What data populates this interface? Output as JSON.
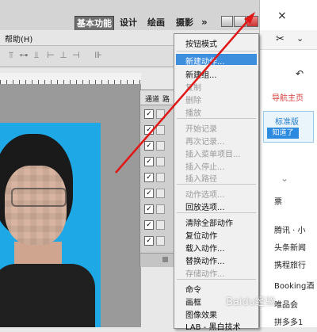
{
  "workspace": {
    "basic": "基本功能",
    "design": "设计",
    "paint": "绘画",
    "photo": "摄影",
    "more": "»"
  },
  "menubar": {
    "help": "帮助(H)"
  },
  "actions_panel": {
    "tab1": "通道",
    "tab2": "路"
  },
  "menu": {
    "items": [
      {
        "label": "按钮模式",
        "disabled": false
      },
      {
        "label": "新建动作...",
        "disabled": false,
        "highlighted": true
      },
      {
        "label": "新建组...",
        "disabled": false
      },
      {
        "label": "复制",
        "disabled": true
      },
      {
        "label": "删除",
        "disabled": true
      },
      {
        "label": "播放",
        "disabled": true
      },
      {
        "label": "开始记录",
        "disabled": true
      },
      {
        "label": "再次记录...",
        "disabled": true
      },
      {
        "label": "插入菜单项目...",
        "disabled": true
      },
      {
        "label": "插入停止...",
        "disabled": true
      },
      {
        "label": "插入路径",
        "disabled": true
      },
      {
        "label": "动作选项...",
        "disabled": true
      },
      {
        "label": "回放选项...",
        "disabled": false
      },
      {
        "label": "清除全部动作",
        "disabled": false
      },
      {
        "label": "复位动作",
        "disabled": false
      },
      {
        "label": "载入动作...",
        "disabled": false
      },
      {
        "label": "替换动作...",
        "disabled": false
      },
      {
        "label": "存储动作...",
        "disabled": true
      },
      {
        "label": "命令",
        "disabled": false
      },
      {
        "label": "画框",
        "disabled": false
      },
      {
        "label": "图像效果",
        "disabled": false
      },
      {
        "label": "LAB - 黑白技术",
        "disabled": false
      }
    ]
  },
  "right_panel": {
    "close": "×",
    "nav_link": "导航主页",
    "notice_a": "标准版",
    "notice_b": "知道了",
    "item_piao": "票",
    "list": [
      "腾讯 · 小",
      "头条新闻",
      "携程旅行",
      "Booking酒",
      "唯品会",
      "拼多多1"
    ]
  },
  "watermark": "Baidu经验"
}
